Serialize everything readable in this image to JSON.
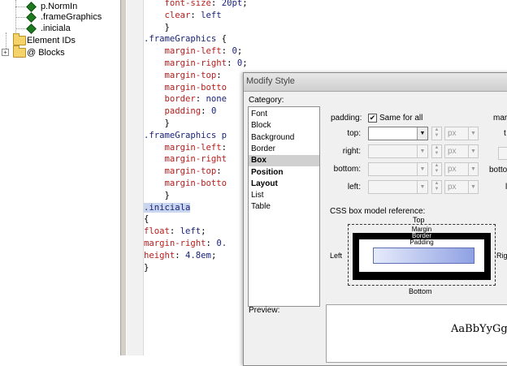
{
  "tree": {
    "items": [
      {
        "label": "p.NormIn"
      },
      {
        "label": ".frameGraphics"
      },
      {
        "label": ".iniciala"
      },
      {
        "label": "Element IDs"
      },
      {
        "label": "@ Blocks"
      }
    ],
    "expander": "+"
  },
  "editor": {
    "lines": [
      {
        "parts": [
          [
            "prop",
            "    font-size"
          ],
          [
            "punc",
            ": "
          ],
          [
            "val",
            "20pt"
          ],
          [
            "punc",
            ";"
          ]
        ]
      },
      {
        "parts": [
          [
            "prop",
            "    clear"
          ],
          [
            "punc",
            ": "
          ],
          [
            "val",
            "left"
          ]
        ]
      },
      {
        "parts": [
          [
            "punc",
            "    }"
          ]
        ]
      },
      {
        "parts": [
          [
            "sel",
            ".frameGraphics"
          ],
          [
            "punc",
            " {"
          ]
        ]
      },
      {
        "parts": [
          [
            "prop",
            "    margin-left"
          ],
          [
            "punc",
            ": "
          ],
          [
            "val",
            "0"
          ],
          [
            "punc",
            ";"
          ]
        ]
      },
      {
        "parts": [
          [
            "prop",
            "    margin-right"
          ],
          [
            "punc",
            ": "
          ],
          [
            "val",
            "0"
          ],
          [
            "punc",
            ";"
          ]
        ]
      },
      {
        "parts": [
          [
            "prop",
            "    margin-top"
          ],
          [
            "punc",
            ":"
          ]
        ]
      },
      {
        "parts": [
          [
            "prop",
            "    margin-botto"
          ]
        ]
      },
      {
        "parts": [
          [
            "prop",
            "    border"
          ],
          [
            "punc",
            ": "
          ],
          [
            "val",
            "none"
          ]
        ]
      },
      {
        "parts": [
          [
            "prop",
            "    padding"
          ],
          [
            "punc",
            ": "
          ],
          [
            "val",
            "0"
          ]
        ]
      },
      {
        "parts": [
          [
            "punc",
            "    }"
          ]
        ]
      },
      {
        "parts": [
          [
            "sel",
            ".frameGraphics p"
          ]
        ]
      },
      {
        "parts": [
          [
            "prop",
            "    margin-left"
          ],
          [
            "punc",
            ":"
          ]
        ]
      },
      {
        "parts": [
          [
            "prop",
            "    margin-right"
          ]
        ]
      },
      {
        "parts": [
          [
            "prop",
            "    margin-top"
          ],
          [
            "punc",
            ":"
          ]
        ]
      },
      {
        "parts": [
          [
            "prop",
            "    margin-botto"
          ]
        ]
      },
      {
        "parts": [
          [
            "punc",
            "    }"
          ]
        ]
      },
      {
        "parts": [
          [
            "sel",
            ".iniciala"
          ]
        ],
        "highlight": true
      },
      {
        "parts": [
          [
            "punc",
            "{"
          ]
        ]
      },
      {
        "parts": [
          [
            "prop",
            "float"
          ],
          [
            "punc",
            ": "
          ],
          [
            "val",
            "left"
          ],
          [
            "punc",
            ";"
          ]
        ]
      },
      {
        "parts": [
          [
            "prop",
            "margin-right"
          ],
          [
            "punc",
            ": "
          ],
          [
            "val",
            "0."
          ]
        ]
      },
      {
        "parts": [
          [
            "prop",
            "height"
          ],
          [
            "punc",
            ": "
          ],
          [
            "val",
            "4.8em"
          ],
          [
            "punc",
            ";"
          ]
        ]
      },
      {
        "parts": [
          [
            "punc",
            "}"
          ]
        ]
      }
    ]
  },
  "dialog": {
    "title": "Modify Style",
    "category_label": "Category:",
    "categories": [
      {
        "label": "Font",
        "bold": false,
        "selected": false
      },
      {
        "label": "Block",
        "bold": false,
        "selected": false
      },
      {
        "label": "Background",
        "bold": false,
        "selected": false
      },
      {
        "label": "Border",
        "bold": false,
        "selected": false
      },
      {
        "label": "Box",
        "bold": true,
        "selected": true
      },
      {
        "label": "Position",
        "bold": true,
        "selected": false
      },
      {
        "label": "Layout",
        "bold": true,
        "selected": false
      },
      {
        "label": "List",
        "bold": false,
        "selected": false
      },
      {
        "label": "Table",
        "bold": false,
        "selected": false
      }
    ],
    "padding": {
      "label": "padding:",
      "same_for_all_label": "Same for all",
      "same_for_all_checked": true,
      "check_glyph": "✔",
      "fields": [
        {
          "label": "top:",
          "value": "",
          "unit": "px",
          "enabled": true
        },
        {
          "label": "right:",
          "value": "",
          "unit": "px",
          "enabled": false
        },
        {
          "label": "bottom:",
          "value": "",
          "unit": "px",
          "enabled": false
        },
        {
          "label": "left:",
          "value": "",
          "unit": "px",
          "enabled": false
        }
      ]
    },
    "margin": {
      "label": "marg",
      "field_labels": [
        "t",
        "r",
        "botto",
        "l"
      ]
    },
    "box_model": {
      "reference_label": "CSS box model reference:",
      "top": "Top",
      "bottom": "Bottom",
      "left": "Left",
      "right": "Rig",
      "margin": "Margin",
      "border": "Border",
      "padding": "Padding"
    },
    "preview": {
      "label": "Preview:",
      "sample_text": "AaBbYyGgL"
    }
  }
}
